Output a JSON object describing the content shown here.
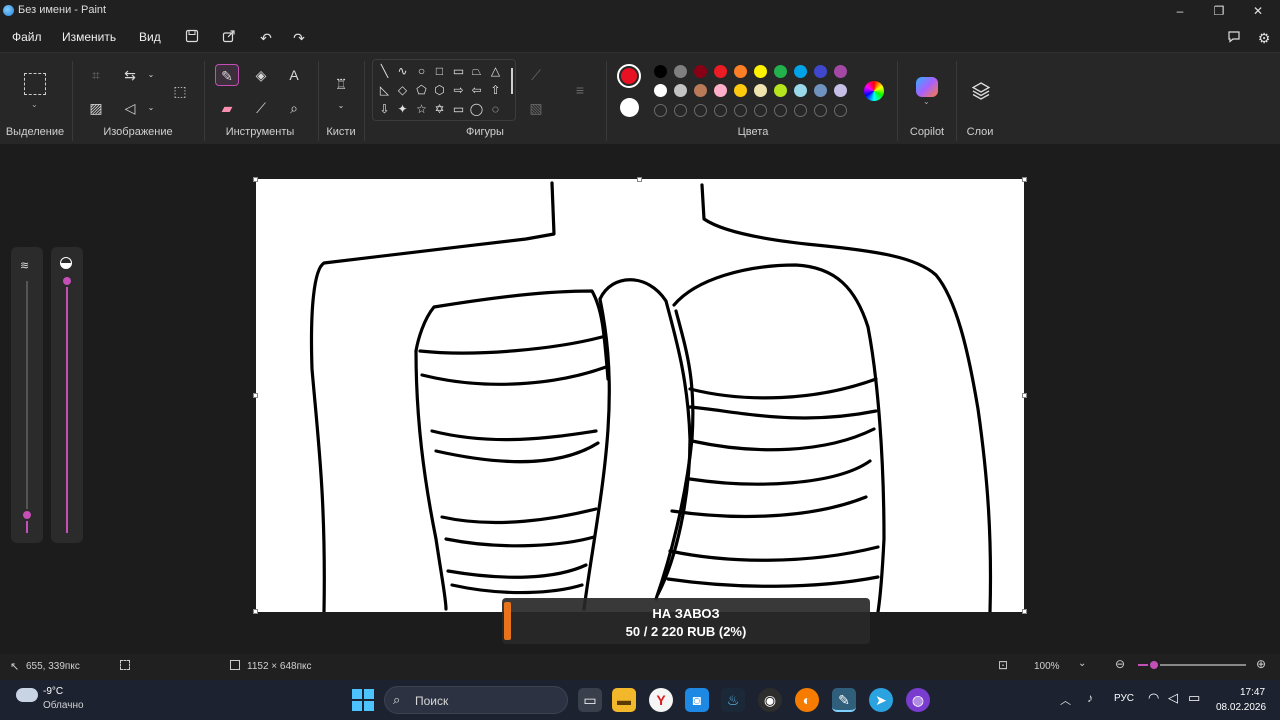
{
  "window": {
    "title": "Без имени - Paint"
  },
  "menu": {
    "file": "Файл",
    "edit": "Изменить",
    "view": "Вид"
  },
  "ribbon": {
    "groups": {
      "selection": "Выделение",
      "image": "Изображение",
      "tools": "Инструменты",
      "brushes": "Кисти",
      "shapes": "Фигуры",
      "colors": "Цвета",
      "copilot": "Copilot",
      "layers": "Слои"
    },
    "colors": {
      "primary": "#e81123",
      "secondary": "#ffffff",
      "row1": [
        "#000000",
        "#7f7f7f",
        "#880015",
        "#ed1c24",
        "#ff7f27",
        "#fff200",
        "#22b14c",
        "#00a2e8",
        "#3f48cc",
        "#a349a4"
      ],
      "row2": [
        "#ffffff",
        "#c3c3c3",
        "#b97a57",
        "#ffaec9",
        "#ffc90e",
        "#efe4b0",
        "#b5e61d",
        "#99d9ea",
        "#7092be",
        "#c8bfe7"
      ]
    },
    "accent": "#c44fb6"
  },
  "sliders": {
    "size_level": 0.07,
    "opacity_level": 1.0
  },
  "donation": {
    "title": "НА ЗАВОЗ",
    "amount": "50 / 2 220 RUB (2%)",
    "progress": 0.02
  },
  "status": {
    "cursor": "655, 339пкс",
    "canvas_size": "1152 × 648пкс",
    "zoom": "100%"
  },
  "taskbar": {
    "weather_temp": "-9°C",
    "weather_desc": "Облачно",
    "search_placeholder": "Поиск",
    "lang": "РУС",
    "time": "17:47",
    "date": "08.02.2026"
  }
}
